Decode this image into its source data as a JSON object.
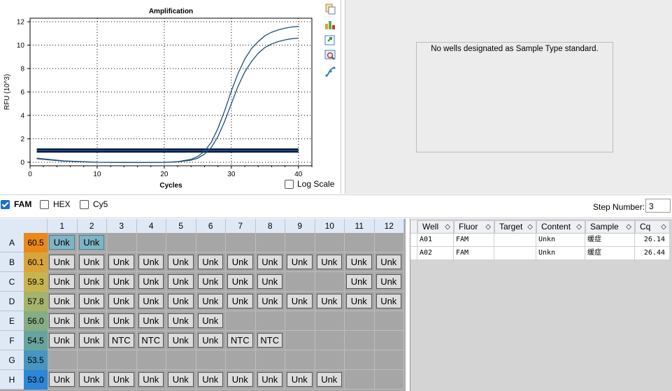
{
  "chart_data": {
    "type": "line",
    "title": "Amplification",
    "xlabel": "Cycles",
    "ylabel": "RFU (10^3)",
    "xlim": [
      0,
      42
    ],
    "ylim": [
      -0.3,
      12.3
    ],
    "x_ticks": [
      "0",
      "10",
      "20",
      "30",
      "40"
    ],
    "y_ticks": [
      "0",
      "2",
      "4",
      "6",
      "8",
      "10",
      "12"
    ],
    "grid": true,
    "threshold": 1.0,
    "series": [
      {
        "x": [
          1,
          5,
          10,
          15,
          20,
          22,
          24,
          25,
          26,
          27,
          28,
          29,
          30,
          31,
          32,
          33,
          34,
          35,
          36,
          37,
          38,
          39,
          40
        ],
        "values": [
          0.35,
          0.12,
          0.0,
          -0.02,
          -0.01,
          0.05,
          0.25,
          0.5,
          0.95,
          1.7,
          2.9,
          4.4,
          6.1,
          7.6,
          8.8,
          9.7,
          10.3,
          10.8,
          11.1,
          11.3,
          11.45,
          11.55,
          11.6
        ]
      },
      {
        "x": [
          1,
          5,
          10,
          15,
          20,
          22,
          24,
          25,
          26,
          27,
          28,
          29,
          30,
          31,
          32,
          33,
          34,
          35,
          36,
          37,
          38,
          39,
          40
        ],
        "values": [
          0.3,
          0.1,
          0.0,
          -0.02,
          -0.01,
          0.04,
          0.18,
          0.35,
          0.7,
          1.25,
          2.2,
          3.5,
          5.0,
          6.5,
          7.7,
          8.6,
          9.3,
          9.8,
          10.1,
          10.3,
          10.45,
          10.55,
          10.6
        ]
      }
    ]
  },
  "chart_controls": {
    "log_scale_label": "Log Scale",
    "log_scale_checked": false
  },
  "toolbar_icons": [
    "copy-icon",
    "export-icon",
    "refresh-icon",
    "zoom-chart-icon",
    "curve-fit-icon"
  ],
  "standard_panel": {
    "message": "No wells designated as Sample Type standard."
  },
  "fluorophores": [
    {
      "label": "FAM",
      "checked": true
    },
    {
      "label": "HEX",
      "checked": false
    },
    {
      "label": "Cy5",
      "checked": false
    }
  ],
  "step": {
    "label": "Step Number:",
    "value": "3"
  },
  "plate": {
    "columns": [
      "1",
      "2",
      "3",
      "4",
      "5",
      "6",
      "7",
      "8",
      "9",
      "10",
      "11",
      "12"
    ],
    "rows": [
      {
        "label": "A",
        "temp": "60.5",
        "temp_color": "#e8891a",
        "cells": [
          "Unk",
          "Unk",
          "",
          "",
          "",
          "",
          "",
          "",
          "",
          "",
          "",
          ""
        ],
        "selected": [
          0,
          1
        ]
      },
      {
        "label": "B",
        "temp": "60.1",
        "temp_color": "#d9a53a",
        "cells": [
          "Unk",
          "Unk",
          "Unk",
          "Unk",
          "Unk",
          "Unk",
          "Unk",
          "Unk",
          "Unk",
          "Unk",
          "Unk",
          "Unk"
        ],
        "selected": []
      },
      {
        "label": "C",
        "temp": "59.3",
        "temp_color": "#c8b44f",
        "cells": [
          "Unk",
          "Unk",
          "Unk",
          "Unk",
          "Unk",
          "Unk",
          "Unk",
          "Unk",
          "",
          "",
          "Unk",
          "Unk"
        ],
        "selected": []
      },
      {
        "label": "D",
        "temp": "57.8",
        "temp_color": "#a6b36b",
        "cells": [
          "Unk",
          "Unk",
          "Unk",
          "Unk",
          "Unk",
          "Unk",
          "Unk",
          "Unk",
          "Unk",
          "Unk",
          "Unk",
          "Unk"
        ],
        "selected": []
      },
      {
        "label": "E",
        "temp": "56.0",
        "temp_color": "#86ad84",
        "cells": [
          "Unk",
          "Unk",
          "Unk",
          "Unk",
          "Unk",
          "Unk",
          "",
          "",
          "",
          "",
          "",
          ""
        ],
        "selected": []
      },
      {
        "label": "F",
        "temp": "54.5",
        "temp_color": "#68a49e",
        "cells": [
          "Unk",
          "Unk",
          "NTC",
          "NTC",
          "Unk",
          "Unk",
          "NTC",
          "NTC",
          "",
          "",
          "",
          ""
        ],
        "selected": []
      },
      {
        "label": "G",
        "temp": "53.5",
        "temp_color": "#4796bf",
        "cells": [
          "",
          "",
          "",
          "",
          "",
          "",
          "",
          "",
          "",
          "",
          "",
          ""
        ],
        "selected": []
      },
      {
        "label": "H",
        "temp": "53.0",
        "temp_color": "#2e86d6",
        "cells": [
          "Unk",
          "Unk",
          "Unk",
          "Unk",
          "Unk",
          "Unk",
          "Unk",
          "Unk",
          "Unk",
          "Unk",
          "",
          ""
        ],
        "selected": []
      }
    ]
  },
  "results": {
    "headers": [
      "Well",
      "Fluor",
      "Target",
      "Content",
      "Sample",
      "Cq"
    ],
    "rows": [
      [
        "A01",
        "FAM",
        "",
        "Unkn",
        "缓症",
        "26.14"
      ],
      [
        "A02",
        "FAM",
        "",
        "Unkn",
        "缓症",
        "26.44"
      ]
    ]
  }
}
